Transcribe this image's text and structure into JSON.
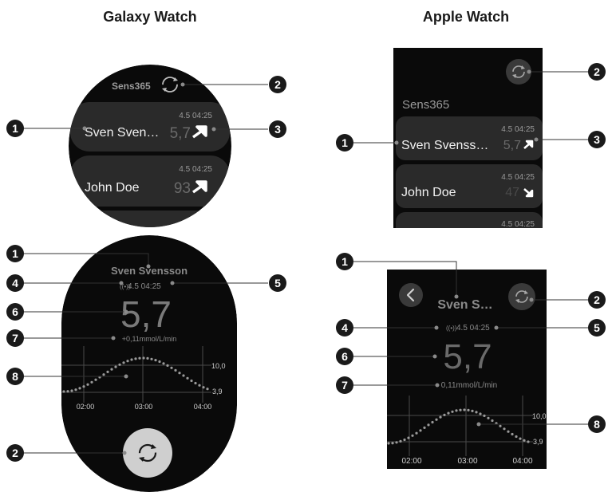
{
  "galaxy": {
    "title": "Galaxy Watch",
    "list": {
      "app_name": "Sens365",
      "items": [
        {
          "name": "Sven Sven…",
          "time": "4.5 04:25",
          "value": "5,7"
        },
        {
          "name": "John Doe",
          "time": "4.5 04:25",
          "value": "93"
        }
      ]
    },
    "detail": {
      "name": "Sven Svensson",
      "time": "4.5 04:25",
      "value": "5,7",
      "rate": "+0,11mmol/L/min",
      "chart": {
        "high": "10,0",
        "low": "3,9",
        "x_labels": [
          "02:00",
          "03:00",
          "04:00"
        ]
      }
    }
  },
  "apple": {
    "title": "Apple Watch",
    "list": {
      "app_name": "Sens365",
      "items": [
        {
          "name": "Sven Svenss…",
          "time": "4.5 04:25",
          "value": "5,7"
        },
        {
          "name": "John Doe",
          "time": "4.5 04:25",
          "value": "47"
        },
        {
          "name": "",
          "time": "4.5 04:25",
          "value": ""
        }
      ]
    },
    "detail": {
      "name": "Sven S…",
      "time": "4.5 04:25",
      "value": "5,7",
      "rate": "0,11mmol/L/min",
      "chart": {
        "high": "10,0",
        "low": "3,9",
        "x_labels": [
          "02:00",
          "03:00",
          "04:00"
        ]
      }
    }
  },
  "callouts": [
    "1",
    "2",
    "3",
    "4",
    "5",
    "6",
    "7",
    "8"
  ],
  "colors": {
    "screen": "#0a0a0a",
    "card": "#2a2a2a",
    "badge": "#1a1a1a",
    "dot": "#9a9a9a"
  }
}
